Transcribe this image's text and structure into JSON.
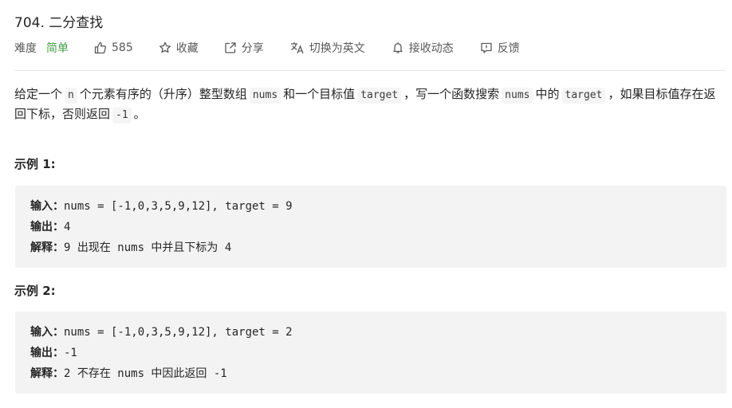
{
  "problem": {
    "title": "704. 二分查找"
  },
  "meta": {
    "difficulty_label": "难度",
    "difficulty_value": "简单",
    "like_count": "585",
    "favorite_label": "收藏",
    "share_label": "分享",
    "translate_label": "切换为英文",
    "activity_label": "接收动态",
    "feedback_label": "反馈",
    "difficulty_color": "#43a047"
  },
  "description": {
    "part1": "给定一个",
    "code_n": "n",
    "part2": "个元素有序的（升序）整型数组",
    "code_nums": "nums",
    "part3": "和一个目标值",
    "code_target": "target",
    "part4": "，写一个函数搜索",
    "code_nums2": "nums",
    "part5": "中的",
    "code_target2": "target",
    "part6": "，如果目标值存在返回下标，否则返回",
    "code_neg1": "-1",
    "part7": "。"
  },
  "examples": [
    {
      "title": "示例 1:",
      "input_key": "输入：",
      "input_value": "nums = [-1,0,3,5,9,12], target = 9",
      "output_key": "输出：",
      "output_value": "4",
      "explain_key": "解释：",
      "explain_value": "9 出现在 nums 中并且下标为 4"
    },
    {
      "title": "示例 2:",
      "input_key": "输入：",
      "input_value": "nums = [-1,0,3,5,9,12], target = 2",
      "output_key": "输出：",
      "output_value": "-1",
      "explain_key": "解释：",
      "explain_value": "2 不存在 nums 中因此返回 -1"
    }
  ],
  "icons": {
    "like": "thumbs-up-icon",
    "favorite": "star-icon",
    "share": "share-icon",
    "translate": "translate-icon",
    "activity": "bell-icon",
    "feedback": "feedback-icon"
  }
}
